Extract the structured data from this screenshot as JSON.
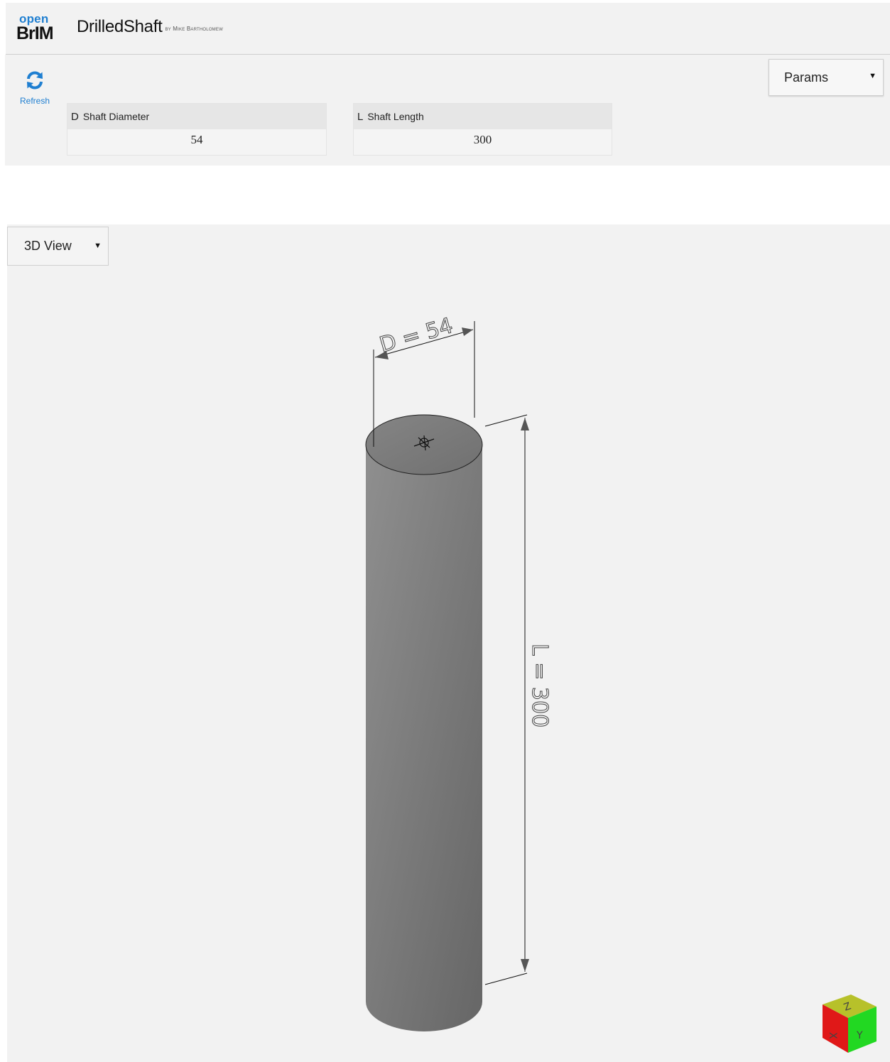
{
  "header": {
    "logo_top": "open",
    "logo_bottom": "BrIM",
    "title": "DrilledShaft",
    "author": "by Mike Bartholomew"
  },
  "toolbar": {
    "refresh_label": "Refresh",
    "params_select": "Params"
  },
  "params": [
    {
      "symbol": "D",
      "name": "Shaft Diameter",
      "value": "54"
    },
    {
      "symbol": "L",
      "name": "Shaft Length",
      "value": "300"
    }
  ],
  "viewer": {
    "view_select": "3D View",
    "dimension_diameter": "D = 54",
    "dimension_length": "L = 300",
    "axes": {
      "x": "X",
      "y": "Y",
      "z": "Z"
    }
  },
  "colors": {
    "accent": "#1f7fd1",
    "panel_bg": "#f2f2f2",
    "shaft_light": "#8f8f8f",
    "shaft_dark": "#666666",
    "cube_x": "#e01818",
    "cube_y": "#22d822",
    "cube_z": "#b7c12a"
  }
}
